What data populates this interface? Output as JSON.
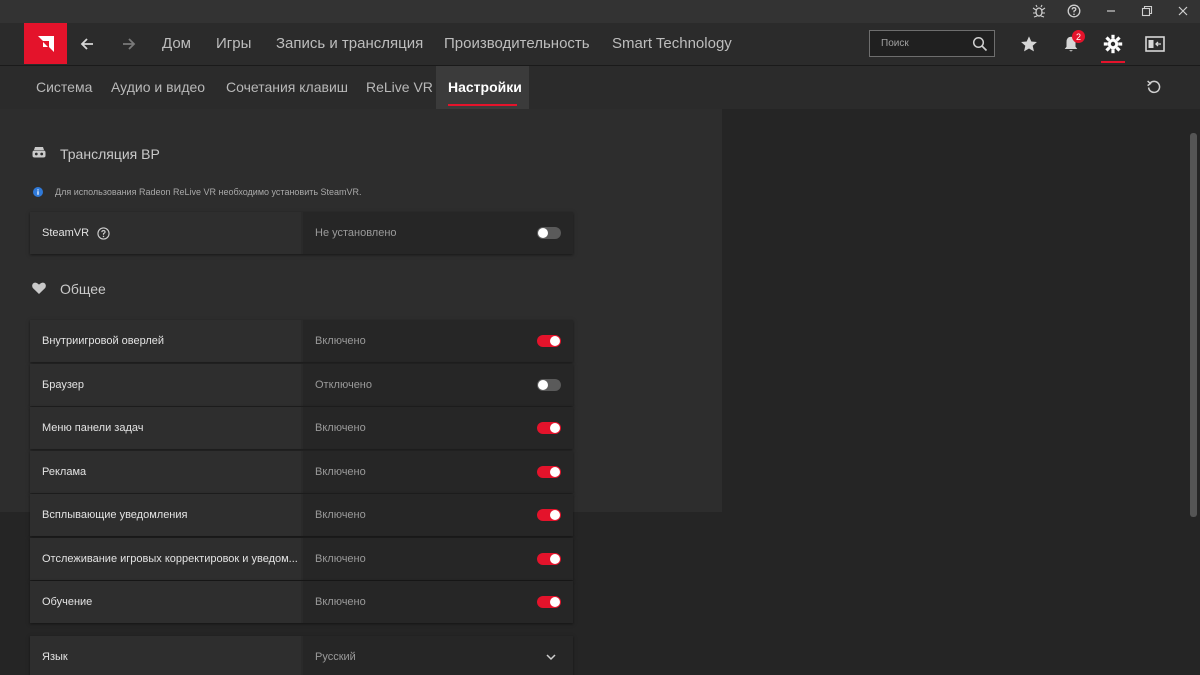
{
  "colors": {
    "accent": "#e4132b",
    "background": "#252525",
    "panel": "#2d2d2d"
  },
  "titlebar": {
    "icons": [
      "bug-report-icon",
      "help-icon",
      "minimize-icon",
      "restore-icon",
      "close-icon"
    ]
  },
  "nav": {
    "items": [
      {
        "label": "Дом"
      },
      {
        "label": "Игры"
      },
      {
        "label": "Запись и трансляция"
      },
      {
        "label": "Производительность"
      },
      {
        "label": "Smart Technology"
      }
    ],
    "search_placeholder": "Поиск",
    "notification_count": "2"
  },
  "tabs": [
    {
      "label": "Система"
    },
    {
      "label": "Аудио и видео"
    },
    {
      "label": "Сочетания клавиш"
    },
    {
      "label": "ReLive VR"
    },
    {
      "label": "Настройки",
      "active": true
    }
  ],
  "sections": {
    "vr": {
      "title": "Трансляция ВР",
      "info": "Для использования Radeon ReLive VR необходимо установить SteamVR.",
      "rows": [
        {
          "label": "SteamVR",
          "value": "Не установлено",
          "toggle_on": false
        }
      ]
    },
    "general": {
      "title": "Общее",
      "rows": [
        {
          "label": "Внутриигровой оверлей",
          "value": "Включено",
          "toggle_on": true
        },
        {
          "label": "Браузер",
          "value": "Отключено",
          "toggle_on": false
        },
        {
          "label": "Меню панели задач",
          "value": "Включено",
          "toggle_on": true
        },
        {
          "label": "Реклама",
          "value": "Включено",
          "toggle_on": true
        },
        {
          "label": "Всплывающие уведомления",
          "value": "Включено",
          "toggle_on": true
        },
        {
          "label": "Отслеживание игровых корректировок и уведом...",
          "value": "Включено",
          "toggle_on": true
        },
        {
          "label": "Обучение",
          "value": "Включено",
          "toggle_on": true
        }
      ]
    },
    "language": {
      "label": "Язык",
      "value": "Русский"
    }
  }
}
